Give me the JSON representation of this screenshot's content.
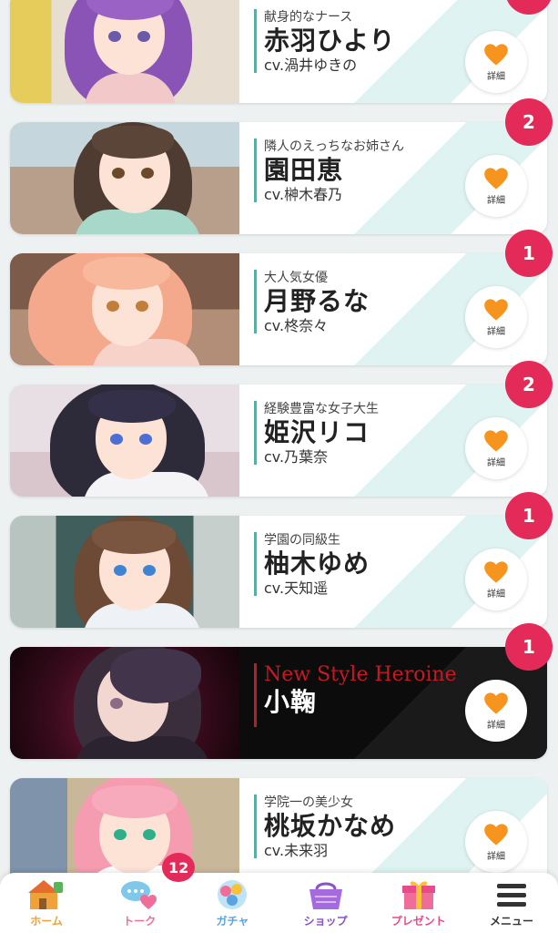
{
  "characters": [
    {
      "role": "献身的なナース",
      "name": "赤羽ひより",
      "cv": "cv.渦井ゆきの",
      "badge": "",
      "detail_label": "詳細",
      "hair_color": "#8a53b6",
      "bg_color": "#d9c8b8"
    },
    {
      "role": "隣人のえっちなお姉さん",
      "name": "園田恵",
      "cv": "cv.榊木春乃",
      "badge": "2",
      "detail_label": "詳細",
      "hair_color": "#4e3b31",
      "bg_color": "#b9c8cf"
    },
    {
      "role": "大人気女優",
      "name": "月野るな",
      "cv": "cv.柊奈々",
      "badge": "1",
      "detail_label": "詳細",
      "hair_color": "#f4a98c",
      "bg_color": "#8c6a58"
    },
    {
      "role": "経験豊富な女子大生",
      "name": "姫沢リコ",
      "cv": "cv.乃葉奈",
      "badge": "2",
      "detail_label": "詳細",
      "hair_color": "#2d2a3a",
      "bg_color": "#d8cfd6"
    },
    {
      "role": "学園の同級生",
      "name": "柚木ゆめ",
      "cv": "cv.天知遥",
      "badge": "1",
      "detail_label": "詳細",
      "hair_color": "#6c4a36",
      "bg_color": "#5d7b78"
    },
    {
      "role": "New Style Heroine",
      "name": "小鞠",
      "cv": "",
      "badge": "1",
      "detail_label": "詳細",
      "hair_color": "#3a2e3c",
      "bg_color": "#4a0f26"
    },
    {
      "role": "学院一の美少女",
      "name": "桃坂かなめ",
      "cv": "cv.未来羽",
      "badge": "",
      "detail_label": "詳細",
      "hair_color": "#f59cb0",
      "bg_color": "#a6b4c6"
    }
  ],
  "tabs": [
    {
      "label": "ホーム",
      "icon": "home-icon",
      "color": "#f0a23a"
    },
    {
      "label": "トーク",
      "icon": "talk-icon",
      "color": "#f06d9a",
      "badge": "12"
    },
    {
      "label": "ガチャ",
      "icon": "gacha-icon",
      "color": "#5aa3e0"
    },
    {
      "label": "ショップ",
      "icon": "shop-icon",
      "color": "#8b52c8"
    },
    {
      "label": "プレゼント",
      "icon": "present-icon",
      "color": "#e94b8a"
    },
    {
      "label": "メニュー",
      "icon": "menu-icon",
      "color": "#333333"
    }
  ],
  "colors": {
    "accent": "#23c6b4",
    "badge": "#e42a58",
    "heart": "#f7941d"
  }
}
